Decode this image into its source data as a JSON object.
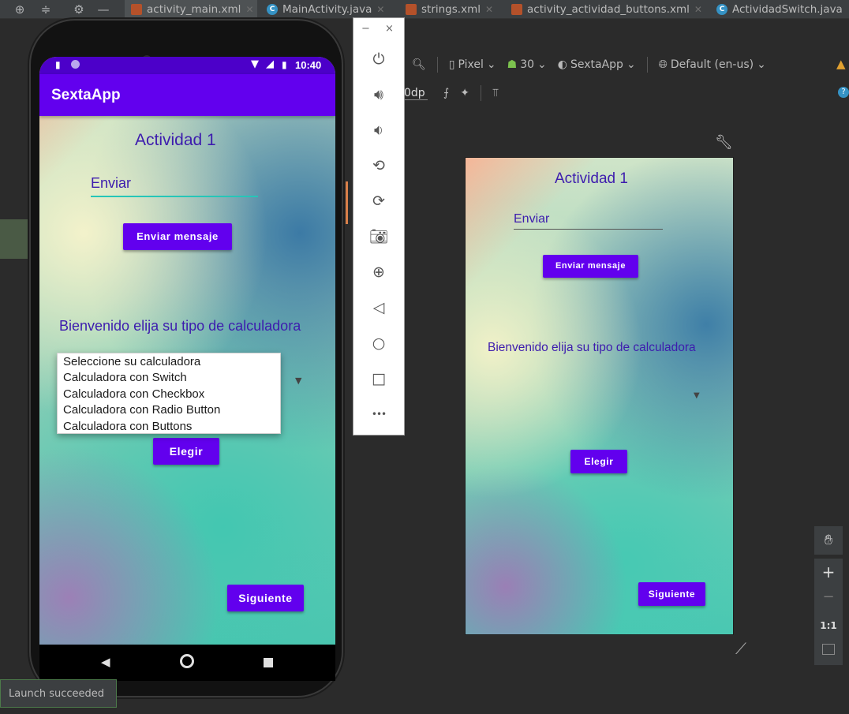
{
  "ide": {
    "tabs": [
      {
        "label": "activity_main.xml",
        "type": "xml"
      },
      {
        "label": "MainActivity.java",
        "type": "java"
      },
      {
        "label": "strings.xml",
        "type": "xml"
      },
      {
        "label": "activity_actividad_buttons.xml",
        "type": "xml"
      },
      {
        "label": "ActividadSwitch.java",
        "type": "java"
      }
    ],
    "toolbar": {
      "device": "Pixel",
      "api": "30",
      "theme": "SextaApp",
      "locale": "Default (en-us)",
      "margin_value": "0dp"
    },
    "zoom": {
      "plus": "+",
      "minus": "−",
      "ratio": "1:1"
    },
    "status_popup": "Launch succeeded"
  },
  "emulator_controls": {
    "minimize": "−",
    "close": "×",
    "more": "•••"
  },
  "phone": {
    "status_bar": {
      "time": "10:40"
    },
    "app_bar": {
      "title": "SextaApp"
    },
    "screen": {
      "title": "Actividad 1",
      "edit_text": "Enviar",
      "send_button": "Enviar mensaje",
      "welcome": "Bienvenido elija su tipo de calculadora",
      "spinner_options": [
        "Seleccione su calculadora",
        "Calculadora con Switch",
        "Calculadora con Checkbox",
        "Calculadora con Radio Button",
        "Calculadora con Buttons"
      ],
      "choose_button": "Elegir",
      "next_button": "Siguiente"
    }
  },
  "preview": {
    "title": "Actividad 1",
    "edit_text": "Enviar",
    "send_button": "Enviar mensaje",
    "welcome": "Bienvenido elija su tipo de calculadora",
    "choose_button": "Elegir",
    "next_button": "Siguiente"
  },
  "colors": {
    "primary": "#6200ee",
    "primary_dark": "#4c00c9",
    "text_accent": "#3d1cae"
  }
}
